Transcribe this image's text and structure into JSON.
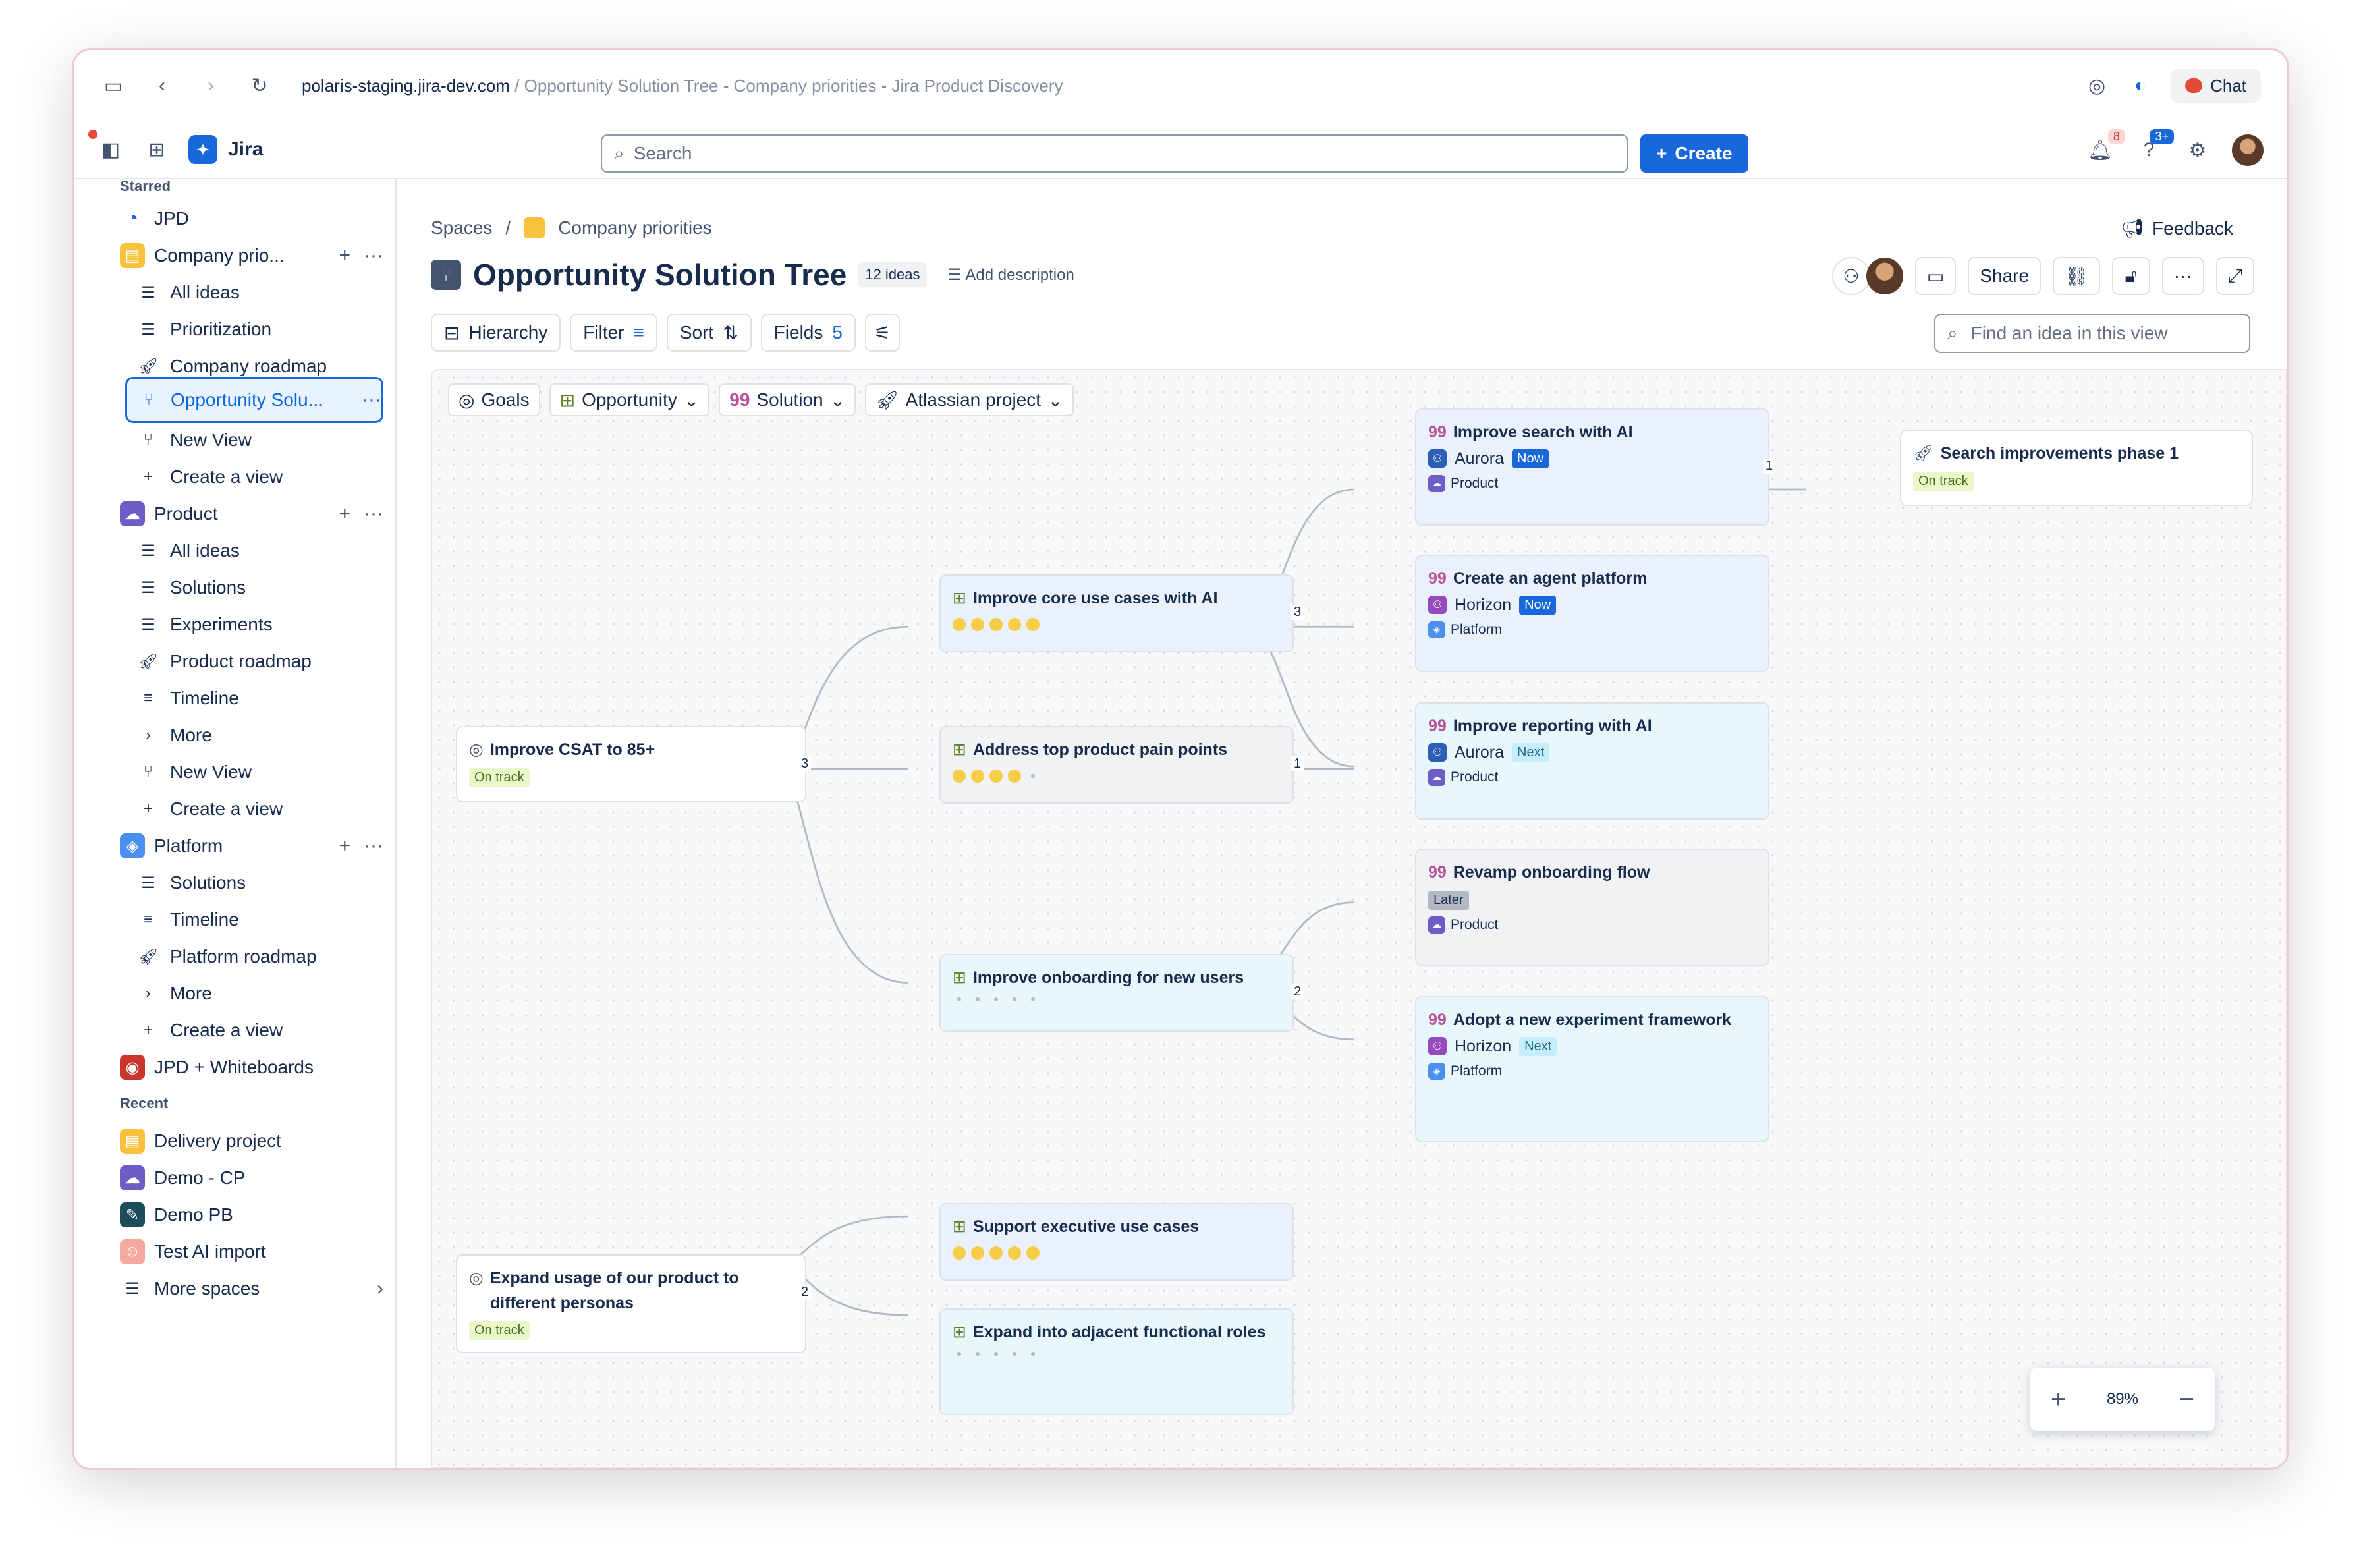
{
  "browser": {
    "url_host": "polaris-staging.jira-dev.com",
    "url_rest": " / Opportunity Solution Tree - Company priorities - Jira Product Discovery",
    "chat_label": "Chat"
  },
  "topnav": {
    "app_name": "Jira",
    "search_placeholder": "Search",
    "create_label": "Create",
    "notifications_count": "8",
    "help_count": "3+"
  },
  "sidebar": {
    "starred_heading": "Starred",
    "recent_heading": "Recent",
    "items": {
      "jpd": "JPD",
      "company_priorities": "Company prio...",
      "cp_all_ideas": "All ideas",
      "cp_prioritization": "Prioritization",
      "cp_roadmap": "Company roadmap",
      "cp_ost": "Opportunity Solu...",
      "cp_new_view": "New View",
      "cp_create_view": "Create a view",
      "product": "Product",
      "p_all_ideas": "All ideas",
      "p_solutions": "Solutions",
      "p_experiments": "Experiments",
      "p_roadmap": "Product roadmap",
      "p_timeline": "Timeline",
      "p_more": "More",
      "p_new_view": "New View",
      "p_create_view": "Create a view",
      "platform": "Platform",
      "pl_solutions": "Solutions",
      "pl_timeline": "Timeline",
      "pl_roadmap": "Platform roadmap",
      "pl_more": "More",
      "pl_create_view": "Create a view",
      "jpd_whiteboards": "JPD + Whiteboards",
      "delivery": "Delivery project",
      "demo_cp": "Demo - CP",
      "demo_pb": "Demo PB",
      "test_ai": "Test AI import",
      "more_spaces": "More spaces"
    }
  },
  "main": {
    "breadcrumb_spaces": "Spaces",
    "breadcrumb_sep": "/",
    "breadcrumb_project": "Company priorities",
    "feedback_label": "Feedback",
    "title": "Opportunity Solution Tree",
    "ideas_count": "12 ideas",
    "add_description": "Add description",
    "share_label": "Share",
    "toolbar": {
      "hierarchy": "Hierarchy",
      "filter": "Filter",
      "sort": "Sort",
      "fields": "Fields",
      "fields_count": "5"
    },
    "find_placeholder": "Find an idea in this view",
    "chips": {
      "goals": "Goals",
      "opportunity": "Opportunity",
      "solution": "Solution",
      "atlassian_project": "Atlassian project"
    },
    "zoom_level": "89%"
  },
  "tree": {
    "goals": [
      {
        "title": "Improve CSAT to 85+",
        "status": "On track",
        "children_count": "3"
      },
      {
        "title": "Expand usage of our product to different personas",
        "status": "On track",
        "children_count": "2"
      }
    ],
    "opportunities": [
      {
        "title": "Improve core use cases with AI",
        "rating": 5,
        "children_count": "3"
      },
      {
        "title": "Address top product pain points",
        "rating": 4,
        "children_count": "1"
      },
      {
        "title": "Improve onboarding for new users",
        "rating": 0,
        "children_count": "2"
      },
      {
        "title": "Support executive use cases",
        "rating": 5
      },
      {
        "title": "Expand into adjacent functional roles",
        "rating": 0
      }
    ],
    "solutions": [
      {
        "title": "Improve search with AI",
        "team": "Aurora",
        "phase": "Now",
        "project": "Product",
        "children_count": "1"
      },
      {
        "title": "Create an agent platform",
        "team": "Horizon",
        "phase": "Now",
        "project": "Platform"
      },
      {
        "title": "Improve reporting with AI",
        "team": "Aurora",
        "phase": "Next",
        "project": "Product"
      },
      {
        "title": "Revamp onboarding flow",
        "phase": "Later",
        "project": "Product"
      },
      {
        "title": "Adopt a new experiment framework",
        "team": "Horizon",
        "phase": "Next",
        "project": "Platform"
      }
    ],
    "projects": [
      {
        "title": "Search improvements phase 1",
        "status": "On track"
      }
    ]
  },
  "colors": {
    "brand": "#1868db",
    "star": "#f5cd47",
    "on_track": "#e9f7c9"
  }
}
